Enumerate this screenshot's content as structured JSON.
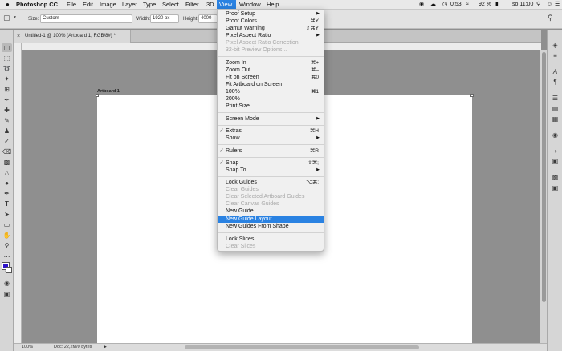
{
  "menubar": {
    "apple": "",
    "items": [
      "Photoshop CC",
      "File",
      "Edit",
      "Image",
      "Layer",
      "Type",
      "Select",
      "Filter",
      "3D",
      "View",
      "Window",
      "Help"
    ],
    "time": "0:53",
    "battery": "92 %",
    "clock": "so 11:00"
  },
  "options": {
    "style_label": "Size:",
    "style_value": "Custom",
    "width_label": "Width:",
    "width_value": "1920 px",
    "height_label": "Height:",
    "height_value": "4000 px"
  },
  "document": {
    "tab_title": "Untitled-1 @ 100% (Artboard 1, RGB/8#) *",
    "artboard_label": "Artboard 1"
  },
  "status": {
    "zoom": "100%",
    "doc": "Doc: 22,2M/0 bytes"
  },
  "colors": {
    "foreground": "#2d13c9",
    "background": "#ffffff",
    "highlight": "#2a82e2"
  },
  "view_menu": {
    "items": [
      {
        "label": "Proof Setup",
        "shortcut": "",
        "submenu": true
      },
      {
        "label": "Proof Colors",
        "shortcut": "⌘Y"
      },
      {
        "label": "Gamut Warning",
        "shortcut": "⇧⌘Y"
      },
      {
        "label": "Pixel Aspect Ratio",
        "shortcut": "",
        "submenu": true
      },
      {
        "label": "Pixel Aspect Ratio Correction",
        "shortcut": "",
        "disabled": true
      },
      {
        "label": "32-bit Preview Options...",
        "shortcut": "",
        "disabled": true
      },
      {
        "label": "Zoom In",
        "shortcut": "⌘+"
      },
      {
        "label": "Zoom Out",
        "shortcut": "⌘–"
      },
      {
        "label": "Fit on Screen",
        "shortcut": "⌘0"
      },
      {
        "label": "Fit Artboard on Screen",
        "shortcut": ""
      },
      {
        "label": "100%",
        "shortcut": "⌘1"
      },
      {
        "label": "200%",
        "shortcut": ""
      },
      {
        "label": "Print Size",
        "shortcut": ""
      },
      {
        "label": "Screen Mode",
        "shortcut": "",
        "submenu": true
      },
      {
        "label": "Extras",
        "shortcut": "⌘H",
        "checked": true
      },
      {
        "label": "Show",
        "shortcut": "",
        "submenu": true
      },
      {
        "label": "Rulers",
        "shortcut": "⌘R",
        "checked": true
      },
      {
        "label": "Snap",
        "shortcut": "⇧⌘;",
        "checked": true
      },
      {
        "label": "Snap To",
        "shortcut": "",
        "submenu": true
      },
      {
        "label": "Lock Guides",
        "shortcut": "⌥⌘;"
      },
      {
        "label": "Clear Guides",
        "shortcut": "",
        "disabled": true
      },
      {
        "label": "Clear Selected Artboard Guides",
        "shortcut": "",
        "disabled": true
      },
      {
        "label": "Clear Canvas Guides",
        "shortcut": "",
        "disabled": true
      },
      {
        "label": "New Guide...",
        "shortcut": ""
      },
      {
        "label": "New Guide Layout...",
        "shortcut": "",
        "highlighted": true
      },
      {
        "label": "New Guides From Shape",
        "shortcut": ""
      },
      {
        "label": "Lock Slices",
        "shortcut": ""
      },
      {
        "label": "Clear Slices",
        "shortcut": "",
        "disabled": true
      }
    ]
  }
}
